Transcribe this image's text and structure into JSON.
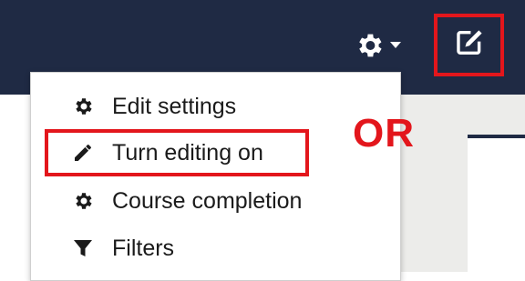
{
  "navbar": {
    "gear_menu_icon": "gear-icon",
    "dropdown_caret_icon": "caret-down-icon",
    "edit_toggle_icon": "edit-square-icon"
  },
  "menu": {
    "items": [
      {
        "label": "Edit settings",
        "icon": "gear-icon"
      },
      {
        "label": "Turn editing on",
        "icon": "pencil-icon"
      },
      {
        "label": "Course completion",
        "icon": "gear-icon"
      },
      {
        "label": "Filters",
        "icon": "filter-icon"
      }
    ]
  },
  "annotation": {
    "or_text": "OR"
  },
  "colors": {
    "navbar": "#1f2a44",
    "highlight": "#e3161c",
    "text": "#1a1a1a"
  }
}
